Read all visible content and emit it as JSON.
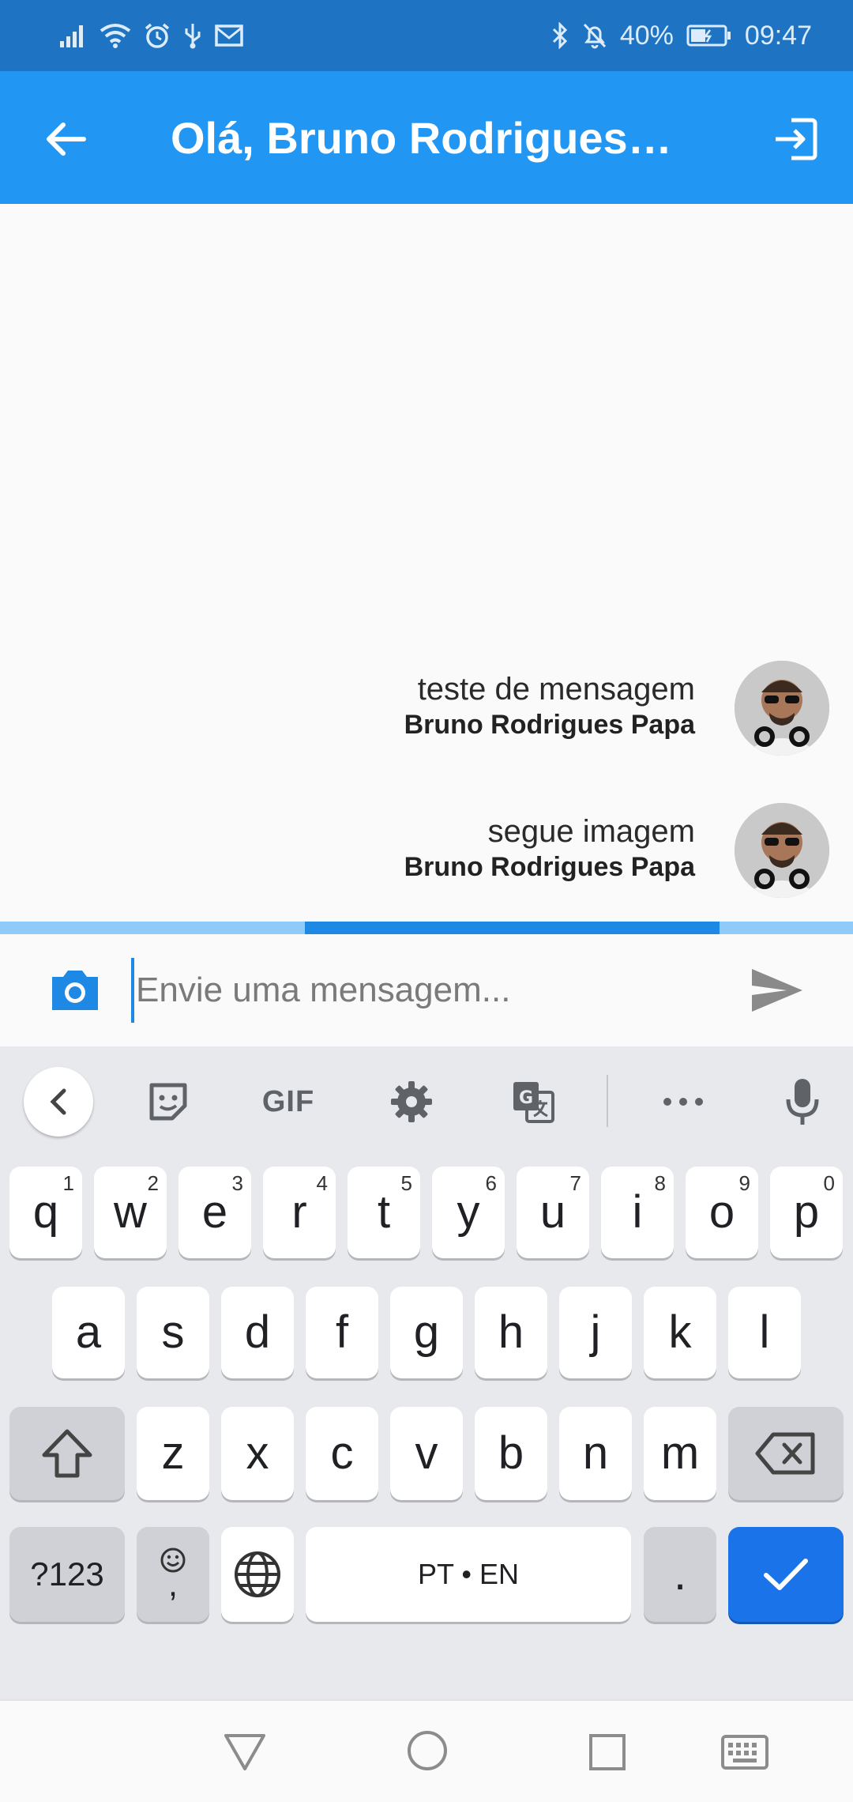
{
  "status_bar": {
    "battery_percent": "40%",
    "time": "09:47"
  },
  "app_bar": {
    "title": "Olá, Bruno Rodrigues Papa"
  },
  "messages": [
    {
      "text": "teste de mensagem",
      "sender": "Bruno Rodrigues Papa"
    },
    {
      "text": "segue imagem",
      "sender": "Bruno Rodrigues Papa"
    }
  ],
  "upload_progress": 0.49,
  "composer": {
    "placeholder": "Envie uma mensagem..."
  },
  "keyboard": {
    "toolbar": {
      "gif_label": "GIF"
    },
    "row1": [
      {
        "label": "q",
        "hint": "1"
      },
      {
        "label": "w",
        "hint": "2"
      },
      {
        "label": "e",
        "hint": "3"
      },
      {
        "label": "r",
        "hint": "4"
      },
      {
        "label": "t",
        "hint": "5"
      },
      {
        "label": "y",
        "hint": "6"
      },
      {
        "label": "u",
        "hint": "7"
      },
      {
        "label": "i",
        "hint": "8"
      },
      {
        "label": "o",
        "hint": "9"
      },
      {
        "label": "p",
        "hint": "0"
      }
    ],
    "row2": [
      "a",
      "s",
      "d",
      "f",
      "g",
      "h",
      "j",
      "k",
      "l"
    ],
    "row3": [
      "z",
      "x",
      "c",
      "v",
      "b",
      "n",
      "m"
    ],
    "symbols_label": "?123",
    "emoji_comma_label": ",",
    "space_label": "PT • EN",
    "period_label": "."
  },
  "colors": {
    "status_bar": "#1e74c2",
    "app_bar": "#2196f3",
    "progress_track": "#90caf9",
    "progress_fill": "#1e88e5",
    "enter_key": "#1a73e8"
  }
}
